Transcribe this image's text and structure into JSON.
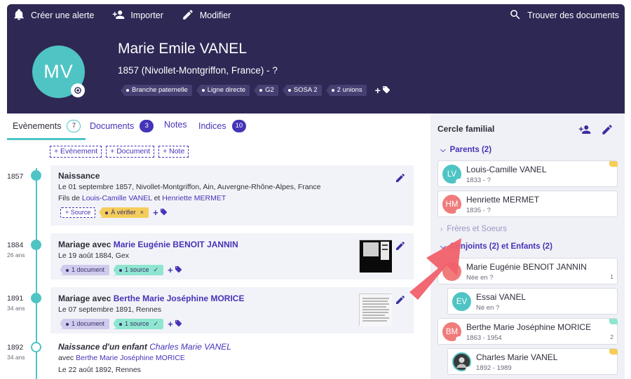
{
  "topbar": {
    "create_alert": "Créer une alerte",
    "import": "Importer",
    "edit": "Modifier",
    "find_docs": "Trouver des documents"
  },
  "person": {
    "initials": "MV",
    "name": "Marie Emile VANEL",
    "dates": "1857 (Nivollet-Montgriffon, France) - ?",
    "tags": [
      "Branche paternelle",
      "Ligne directe",
      "G2",
      "SOSA 2",
      "2 unions"
    ],
    "tag_add": "+"
  },
  "tabs": [
    {
      "label": "Evènements",
      "count": "7"
    },
    {
      "label": "Documents",
      "count": "3"
    },
    {
      "label": "Notes",
      "count": ""
    },
    {
      "label": "Indices",
      "count": "10"
    }
  ],
  "add_buttons": [
    "+ Evènement",
    "+ Document",
    "+ Note"
  ],
  "events": [
    {
      "year": "1857",
      "age": "",
      "title": "Naissance",
      "line1": "Le 01 septembre 1857, Nivollet-Montgriffon, Ain, Auvergne-Rhône-Alpes, France",
      "parents_prefix": "Fils de",
      "parent1": "Louis-Camille VANEL",
      "parents_and": "et",
      "parent2": "Henriette MERMET",
      "chip_source": "+ Source",
      "chip_verify": "À vérifier",
      "chip_verify_x": "×",
      "plus": "+"
    },
    {
      "year": "1884",
      "age": "26 ans",
      "title_prefix": "Mariage avec",
      "title_link": "Marie Eugénie BENOIT JANNIN",
      "line1": "Le 19 août 1884, Gex",
      "chip_doc": "1 document",
      "chip_src": "1 source",
      "chip_check": "✓",
      "plus": "+"
    },
    {
      "year": "1891",
      "age": "34 ans",
      "title_prefix": "Mariage avec",
      "title_link": "Berthe Marie Joséphine MORICE",
      "line1": "Le 07 septembre 1891, Rennes",
      "chip_doc": "1 document",
      "chip_src": "1 source",
      "chip_check": "✓",
      "plus": "+"
    },
    {
      "year": "1892",
      "age": "34 ans",
      "title_prefix": "Naissance d'un enfant",
      "title_link": "Charles Marie VANEL",
      "with_prefix": "avec",
      "with_link": "Berthe Marie Joséphine MORICE",
      "line1": "Le 22 août 1892, Rennes"
    }
  ],
  "family": {
    "title": "Cercle familial",
    "parents_label": "Parents (2)",
    "siblings_label": "Frères et Soeurs",
    "spouses_label": "Conjoints (2) et Enfants (2)",
    "people": [
      {
        "initials": "LV",
        "name": "Louis-Camille VANEL",
        "sub": "1833 - ?",
        "num": "",
        "color": "#4fc4c4",
        "flag": "#f5cd5a"
      },
      {
        "initials": "HM",
        "name": "Henriette MERMET",
        "sub": "1835 - ?",
        "num": "",
        "color": "#f07b7b",
        "flag": ""
      },
      {
        "initials": "",
        "name": "Marie Eugénie BENOIT JANNIN",
        "sub": "Née en ?",
        "num": "1",
        "color": "#f07b7b",
        "flag": ""
      },
      {
        "initials": "EV",
        "name": "Essai VANEL",
        "sub": "Né en ?",
        "num": "",
        "color": "#4fc4c4",
        "flag": ""
      },
      {
        "initials": "BM",
        "name": "Berthe Marie Joséphine MORICE",
        "sub": "1863 - 1954",
        "num": "2",
        "color": "#f07b7b",
        "flag": "#8fe6d0"
      },
      {
        "initials": "",
        "name": "Charles Marie VANEL",
        "sub": "1892 - 1989",
        "num": "",
        "color": "#2e2e2e",
        "flag": "#f5cd5a"
      }
    ]
  },
  "colors": {
    "brand_dark": "#2e2855",
    "accent": "#4434b8",
    "teal": "#4fc4c4",
    "red_arrow": "#f0606a"
  }
}
